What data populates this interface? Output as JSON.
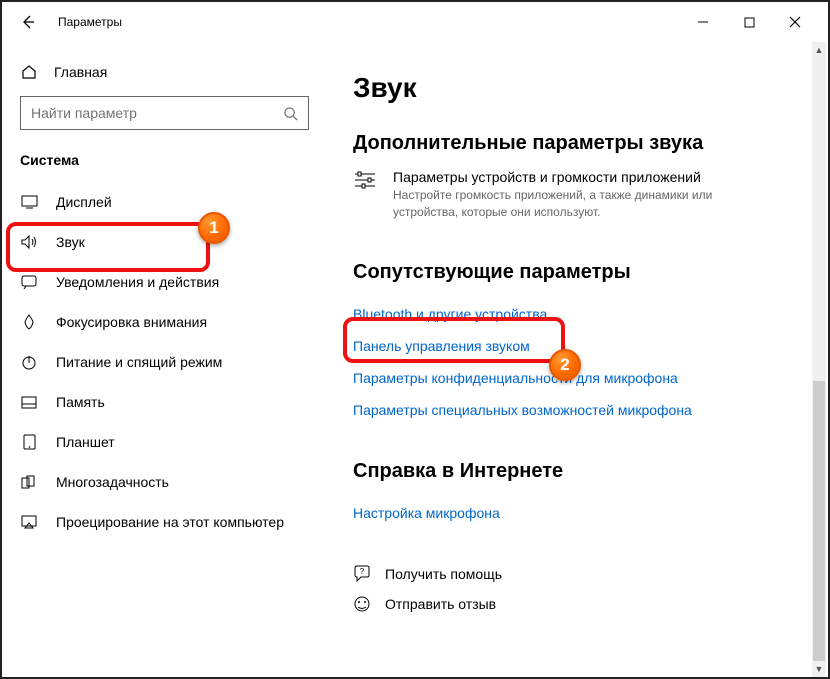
{
  "titlebar": {
    "title": "Параметры"
  },
  "sidebar": {
    "home": "Главная",
    "search_placeholder": "Найти параметр",
    "section": "Система",
    "items": [
      {
        "label": "Дисплей"
      },
      {
        "label": "Звук"
      },
      {
        "label": "Уведомления и действия"
      },
      {
        "label": "Фокусировка внимания"
      },
      {
        "label": "Питание и спящий режим"
      },
      {
        "label": "Память"
      },
      {
        "label": "Планшет"
      },
      {
        "label": "Многозадачность"
      },
      {
        "label": "Проецирование на этот компьютер"
      }
    ]
  },
  "main": {
    "title": "Звук",
    "advanced": {
      "heading": "Дополнительные параметры звука",
      "item_title": "Параметры устройств и громкости приложений",
      "item_desc": "Настройте громкость приложений, а также динамики или устройства, которые они используют."
    },
    "related": {
      "heading": "Сопутствующие параметры",
      "links": [
        "Bluetooth и другие устройства",
        "Панель управления звуком",
        "Параметры конфиденциальности для микрофона",
        "Параметры специальных возможностей микрофона"
      ]
    },
    "help": {
      "heading": "Справка в Интернете",
      "link": "Настройка микрофона"
    },
    "footer": {
      "get_help": "Получить помощь",
      "feedback": "Отправить отзыв"
    }
  },
  "annotations": {
    "badge1": "1",
    "badge2": "2"
  }
}
